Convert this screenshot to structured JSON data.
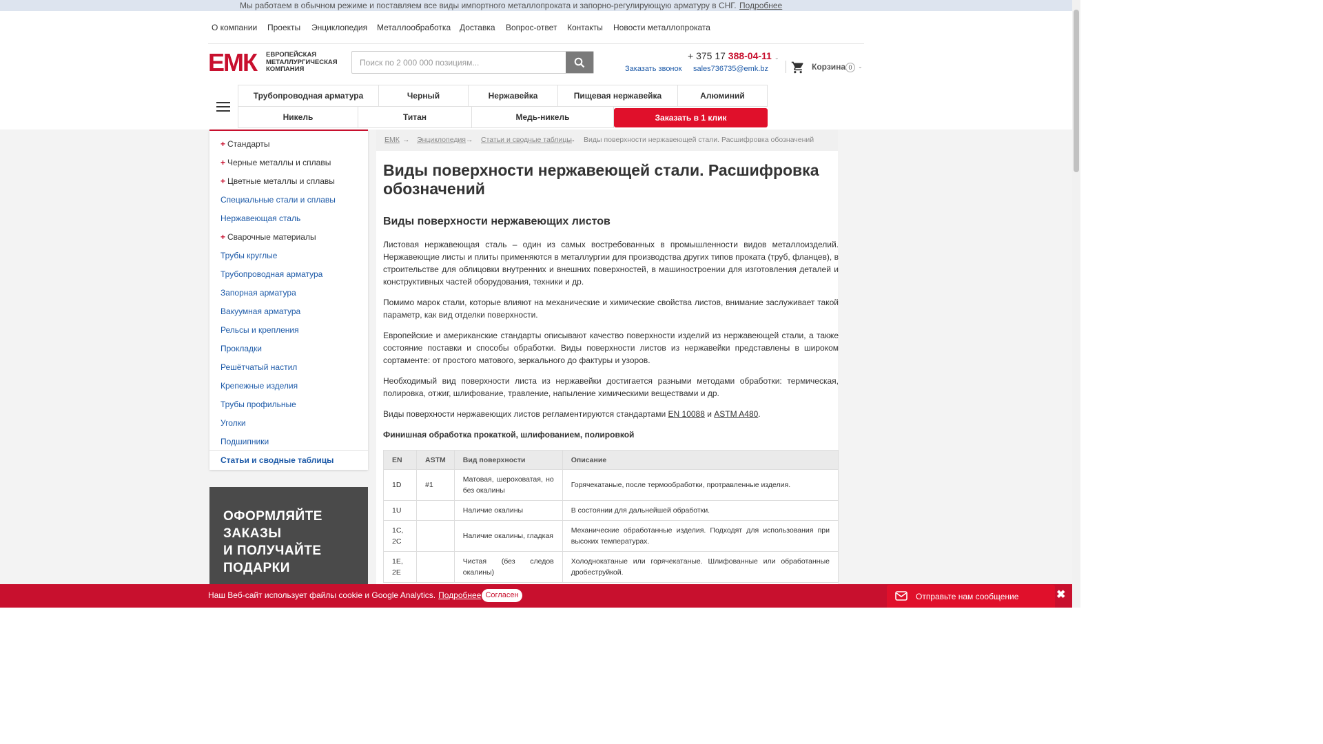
{
  "topbar": {
    "message": "Мы работаем в обычном режиме и поставляем все виды импортного металлопроката и запорно-регулирующую арматуру в СНГ.",
    "more": "Подробнее"
  },
  "topnav": [
    "О компании",
    "Проекты",
    "Энциклопедия",
    "Металлообработка",
    "Доставка",
    "Вопрос-ответ",
    "Контакты",
    "Новости металлопроката"
  ],
  "logo": {
    "mark": "ЕМК",
    "line1": "ЕВРОПЕЙСКАЯ",
    "line2": "МЕТАЛЛУРГИЧЕСКАЯ",
    "line3": "КОМПАНИЯ"
  },
  "search": {
    "placeholder": "Поиск по 2 000 000 позициям..."
  },
  "contacts": {
    "phone_prefix": "+ 375 17 ",
    "phone_main": "388-04-11",
    "callback": "Заказать звонок",
    "email": "sales736735@emk.bz"
  },
  "cart": {
    "label": "Корзина",
    "count": "0"
  },
  "categories": {
    "row1": [
      "Трубопроводная арматура",
      "Черный",
      "Нержавейка",
      "Пищевая нержавейка",
      "Алюминий"
    ],
    "row2": [
      "Никель",
      "Титан",
      "Медь-никель"
    ],
    "order_button": "Заказать в 1 клик"
  },
  "sidebar": {
    "items": [
      {
        "label": "Стандарты",
        "plus": "+"
      },
      {
        "label": "Черные металлы и сплавы",
        "plus": "+"
      },
      {
        "label": "Цветные металлы и сплавы",
        "plus": "+"
      },
      {
        "label": "Специальные стали и сплавы"
      },
      {
        "label": "Нержавеющая сталь"
      },
      {
        "label": "Сварочные материалы",
        "plus": "+"
      },
      {
        "label": "Трубы круглые"
      },
      {
        "label": "Трубопроводная арматура"
      },
      {
        "label": "Запорная арматура"
      },
      {
        "label": "Вакуумная арматура"
      },
      {
        "label": "Рельсы и крепления"
      },
      {
        "label": "Прокладки"
      },
      {
        "label": "Решётчатый настил"
      },
      {
        "label": "Крепежные изделия"
      },
      {
        "label": "Трубы профильные"
      },
      {
        "label": "Уголки"
      },
      {
        "label": "Подшипники"
      },
      {
        "label": "Статьи и сводные таблицы"
      }
    ]
  },
  "promo": [
    "ОФОРМЛЯЙТЕ",
    "ЗАКАЗЫ",
    "И ПОЛУЧАЙТЕ",
    "ПОДАРКИ"
  ],
  "breadcrumb": {
    "b1": "ЕМК",
    "b2": "Энциклопедия",
    "b3": "Статьи и сводные таблицы",
    "current": "Виды поверхности нержавеющей стали. Расшифровка обозначений",
    "arrow": "→"
  },
  "article": {
    "title": "Виды поверхности нержавеющей стали. Расшифровка обозначений",
    "subtitle": "Виды поверхности нержавеющих листов",
    "p1": "Листовая нержавеющая сталь – один из самых востребованных в промышленности видов металлоизделий. Нержавеющие листы и плиты применяются в металлургии для производства других типов проката (труб, фланцев), в строительстве для облицовки внутренних и внешних поверхностей, в машиностроении для изготовления деталей и конструктивных частей оборудования, техники и др.",
    "p2": "Помимо марок стали, которые влияют на механические и химические свойства листов, внимание заслуживает такой параметр, как вид отделки поверхности.",
    "p3": "Европейские и американские стандарты описывают качество поверхности изделий из нержавеющей стали, а также состояние поставки и способы обработки. Виды поверхности листов из нержавейки представлены в широком сортаменте: от простого матового, зеркального до фактуры и узоров.",
    "p4": "Необходимый вид поверхности листа из нержавейки достигается разными методами обработки: термическая, полировка, отжиг, шлифование, травление, напыление химическими веществами и др.",
    "p5_pre": "Виды поверхности нержавеющих листов регламентируются стандартами ",
    "p5_link1": "EN 10088",
    "p5_mid": " и ",
    "p5_link2": "ASTM A480",
    "p5_post": ".",
    "section": "Финишная обработка прокаткой, шлифованием, полировкой"
  },
  "table": {
    "headers": [
      "EN",
      "ASTM",
      "Вид поверхности",
      "Описание"
    ],
    "rows": [
      [
        "1D",
        "#1",
        "Матовая, шероховатая, но без окалины",
        "Горячекатаные, после термообработки, протравленные изделия."
      ],
      [
        "1U",
        "",
        "Наличие окалины",
        "В состоянии для дальнейшей обработки."
      ],
      [
        "1С, 2С",
        "",
        "Наличие окалины, гладкая",
        "Механические обработанные изделия. Подходят для использования при высоких температурах."
      ],
      [
        "1E, 2E",
        "",
        "Чистая (без следов окалины)",
        "Холоднокатаные или горячекатаные. Шлифованные или обработанные дробеструйкой."
      ]
    ]
  },
  "cookie": {
    "text": "Наш Веб-сайт использует файлы cookie и Google Analytics.",
    "more": "Подробнее",
    "agree": "Согласен"
  },
  "chat": {
    "label": "Отправьте нам сообщение",
    "close": "✖"
  }
}
